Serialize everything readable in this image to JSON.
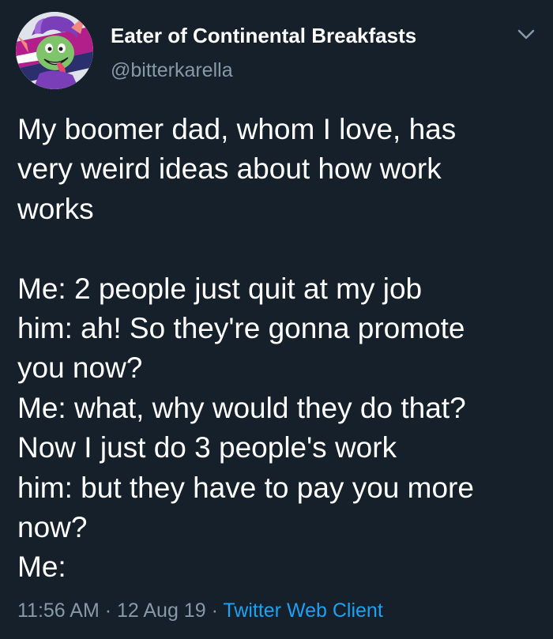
{
  "user": {
    "display_name": "Eater of Continental Breakfasts",
    "handle": "@bitterkarella",
    "avatar_icon": "cartoon-character-avatar"
  },
  "menu": {
    "icon": "chevron-down-icon"
  },
  "tweet": {
    "lines": [
      "My boomer dad, whom I love, has",
      "very weird ideas about how work",
      "works",
      "",
      "Me: 2 people just quit at my job",
      "him: ah! So they're gonna promote",
      "you now?",
      "Me: what, why would they do that?",
      "Now I just do 3 people's work",
      "him: but they have to pay you more",
      "now?",
      "Me:"
    ]
  },
  "meta": {
    "time": "11:56 AM",
    "separator": " · ",
    "date": "12 Aug 19",
    "client": "Twitter Web Client"
  },
  "colors": {
    "background": "#15202b",
    "text": "#ffffff",
    "secondary": "#8899a6",
    "link": "#1da1f2"
  }
}
